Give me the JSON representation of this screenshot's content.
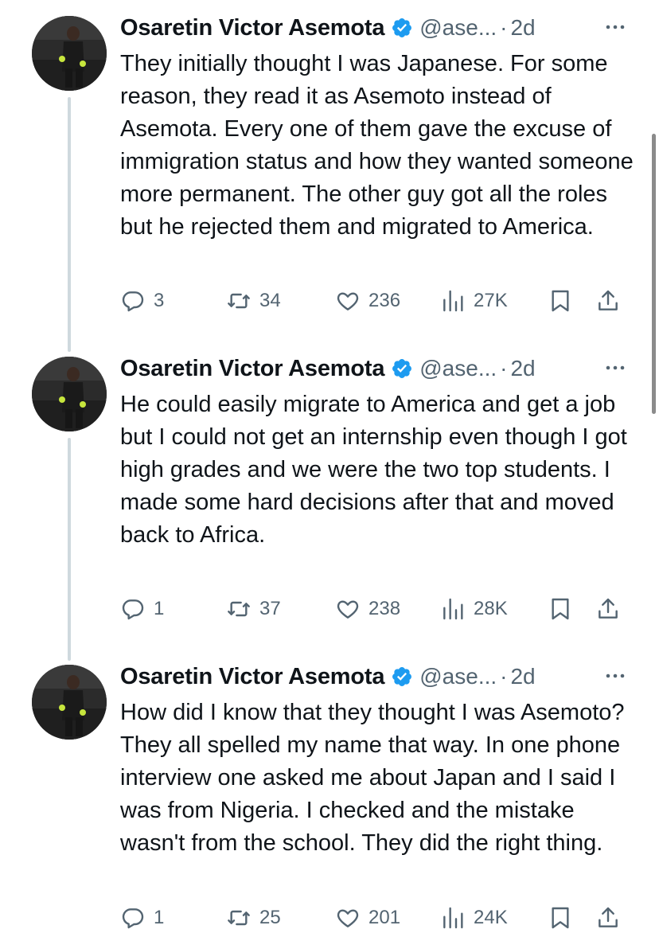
{
  "tweets": [
    {
      "author_name": "Osaretin Victor Asemota",
      "handle": "@ase...",
      "separator": "·",
      "time": "2d",
      "text": "They initially thought I was Japanese. For some reason, they read it as Asemoto instead of Asemota. Every one of them gave the excuse of immigration status and how they wanted someone more permanent. The other guy got all the roles but he rejected them and migrated to America.",
      "replies": "3",
      "reposts": "34",
      "likes": "236",
      "views": "27K"
    },
    {
      "author_name": "Osaretin Victor Asemota",
      "handle": "@ase...",
      "separator": "·",
      "time": "2d",
      "text": "He could easily migrate to America and get a job but I could not get an internship even though I got high grades and we were the two top students. I made some hard decisions after that and moved back to Africa.",
      "replies": "1",
      "reposts": "37",
      "likes": "238",
      "views": "28K"
    },
    {
      "author_name": "Osaretin Victor Asemota",
      "handle": "@ase...",
      "separator": "·",
      "time": "2d",
      "text": "How did I know that they thought I was Asemoto? They all spelled my name that way. In one phone interview one asked me about Japan and I said I was from Nigeria. I checked and the mistake wasn't from the school. They did the right thing.",
      "replies": "1",
      "reposts": "25",
      "likes": "201",
      "views": "24K"
    }
  ],
  "icons": {
    "verified": "verified-badge-icon",
    "more": "more-options-icon",
    "reply": "reply-icon",
    "repost": "repost-icon",
    "like": "like-icon",
    "views": "views-icon",
    "bookmark": "bookmark-icon",
    "share": "share-icon"
  },
  "colors": {
    "text": "#0f1419",
    "secondary": "#536471",
    "verified": "#1d9bf0",
    "thread_line": "#cfd9de"
  }
}
